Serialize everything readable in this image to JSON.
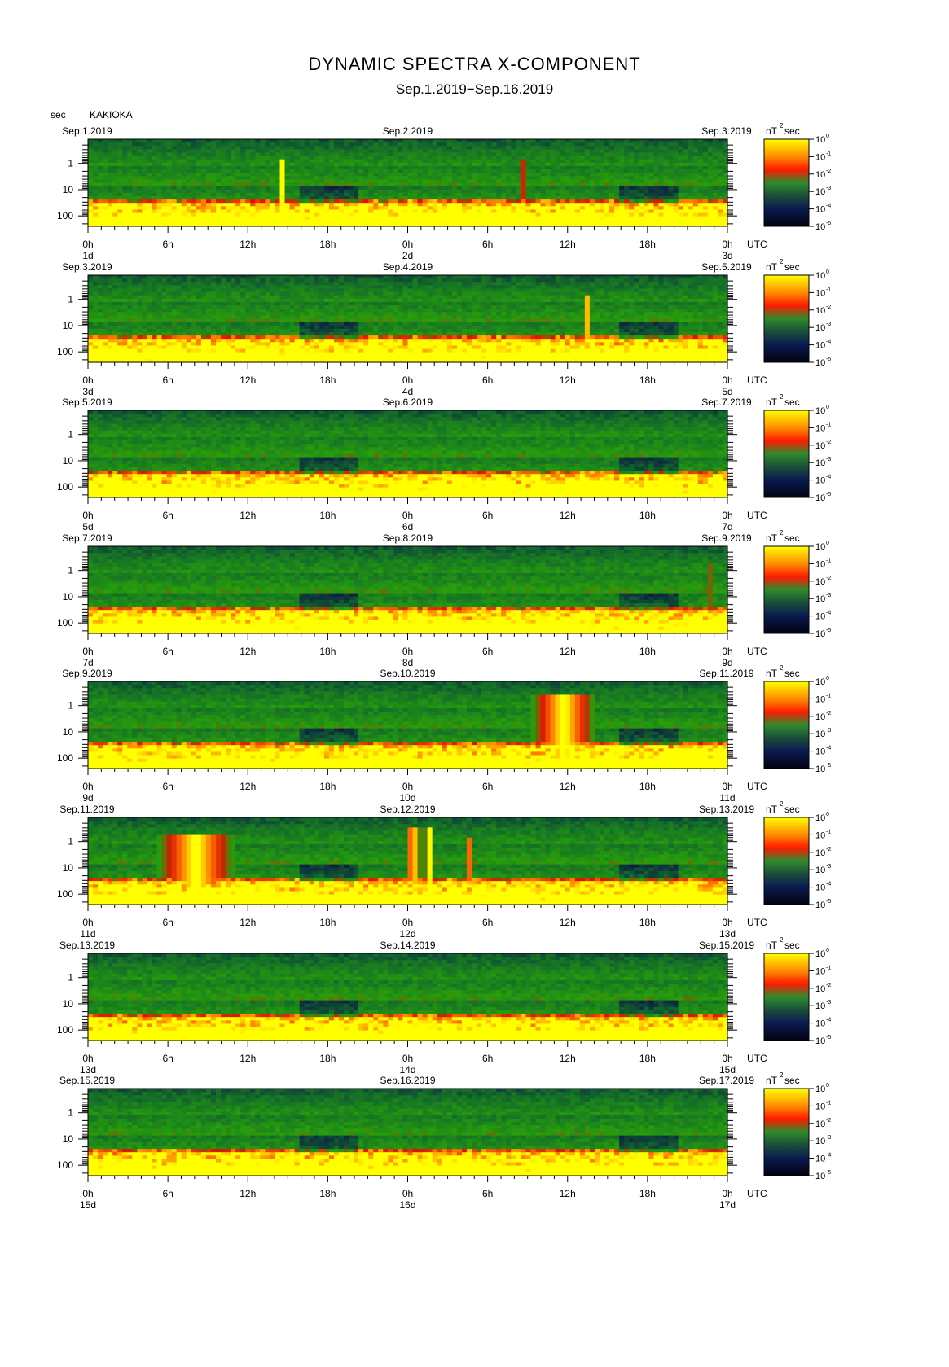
{
  "title": "DYNAMIC SPECTRA X-COMPONENT",
  "subtitle": "Sep.1.2019−Sep.16.2019",
  "y_unit": "sec",
  "station": "KAKIOKA",
  "colorbar_unit": "nT",
  "colorbar_unit_exp": "2",
  "colorbar_unit_sec": "sec",
  "utc_label": "UTC",
  "chart_data": {
    "type": "heatmap",
    "xlabel": "UTC",
    "ylabel": "sec",
    "y_scale": "log",
    "y_ticks": [
      "1",
      "10",
      "100"
    ],
    "x_ticks": [
      "0h",
      "6h",
      "12h",
      "18h",
      "0h",
      "6h",
      "12h",
      "18h",
      "0h"
    ],
    "colorbar": {
      "scale": "log",
      "tick_labels": [
        "10",
        "10",
        "10",
        "10",
        "10",
        "10"
      ],
      "exponents": [
        "0",
        "-1",
        "-2",
        "-3",
        "-4",
        "-5"
      ],
      "colors": [
        "#ffff00",
        "#ff8800",
        "#ff0000",
        "#228b22",
        "#0a1a40",
        "#000000"
      ]
    },
    "panels": [
      {
        "start": "Sep.1.2019",
        "mid": "Sep.2.2019",
        "end": "Sep.3.2019",
        "d0": "1d",
        "d1": "2d",
        "d2": "3d",
        "events": [
          {
            "x": 0.3,
            "w": 0.004,
            "lo": 1.25,
            "hi": 3.4
          },
          {
            "x": 0.675,
            "w": 0.003,
            "lo": 1.5,
            "hi": 3.4
          }
        ]
      },
      {
        "start": "Sep.3.2019",
        "mid": "Sep.4.2019",
        "end": "Sep.5.2019",
        "d0": "3d",
        "d1": "4d",
        "d2": "5d",
        "events": [
          {
            "x": 0.776,
            "w": 0.004,
            "lo": 1.25,
            "hi": 3.4
          }
        ]
      },
      {
        "start": "Sep.5.2019",
        "mid": "Sep.6.2019",
        "end": "Sep.7.2019",
        "d0": "5d",
        "d1": "6d",
        "d2": "7d",
        "events": []
      },
      {
        "start": "Sep.7.2019",
        "mid": "Sep.8.2019",
        "end": "Sep.9.2019",
        "d0": "7d",
        "d1": "8d",
        "d2": "9d",
        "events": [
          {
            "x": 0.966,
            "w": 0.004,
            "lo": 1.1,
            "hi": 3.4
          }
        ]
      },
      {
        "start": "Sep.9.2019",
        "mid": "Sep.10.2019",
        "end": "Sep.11.2019",
        "d0": "9d",
        "d1": "10d",
        "d2": "11d",
        "events": [
          {
            "x": 0.74,
            "w": 0.05,
            "lo": 0.8,
            "hi": 3.4
          }
        ]
      },
      {
        "start": "Sep.11.2019",
        "mid": "Sep.12.2019",
        "end": "Sep.13.2019",
        "d0": "11d",
        "d1": "12d",
        "d2": "13d",
        "events": [
          {
            "x": 0.165,
            "w": 0.06,
            "lo": 0.9,
            "hi": 3.4
          },
          {
            "x": 0.505,
            "w": 0.012,
            "lo": 0.6,
            "hi": 2.7
          },
          {
            "x": 0.53,
            "w": 0.008,
            "lo": 0.6,
            "hi": 2.8
          },
          {
            "x": 0.594,
            "w": 0.004,
            "lo": 1.5,
            "hi": 2.7
          }
        ]
      },
      {
        "start": "Sep.13.2019",
        "mid": "Sep.14.2019",
        "end": "Sep.15.2019",
        "d0": "13d",
        "d1": "14d",
        "d2": "15d",
        "events": []
      },
      {
        "start": "Sep.15.2019",
        "mid": "Sep.16.2019",
        "end": "Sep.17.2019",
        "d0": "15d",
        "d1": "16d",
        "d2": "17d",
        "events": []
      }
    ]
  }
}
